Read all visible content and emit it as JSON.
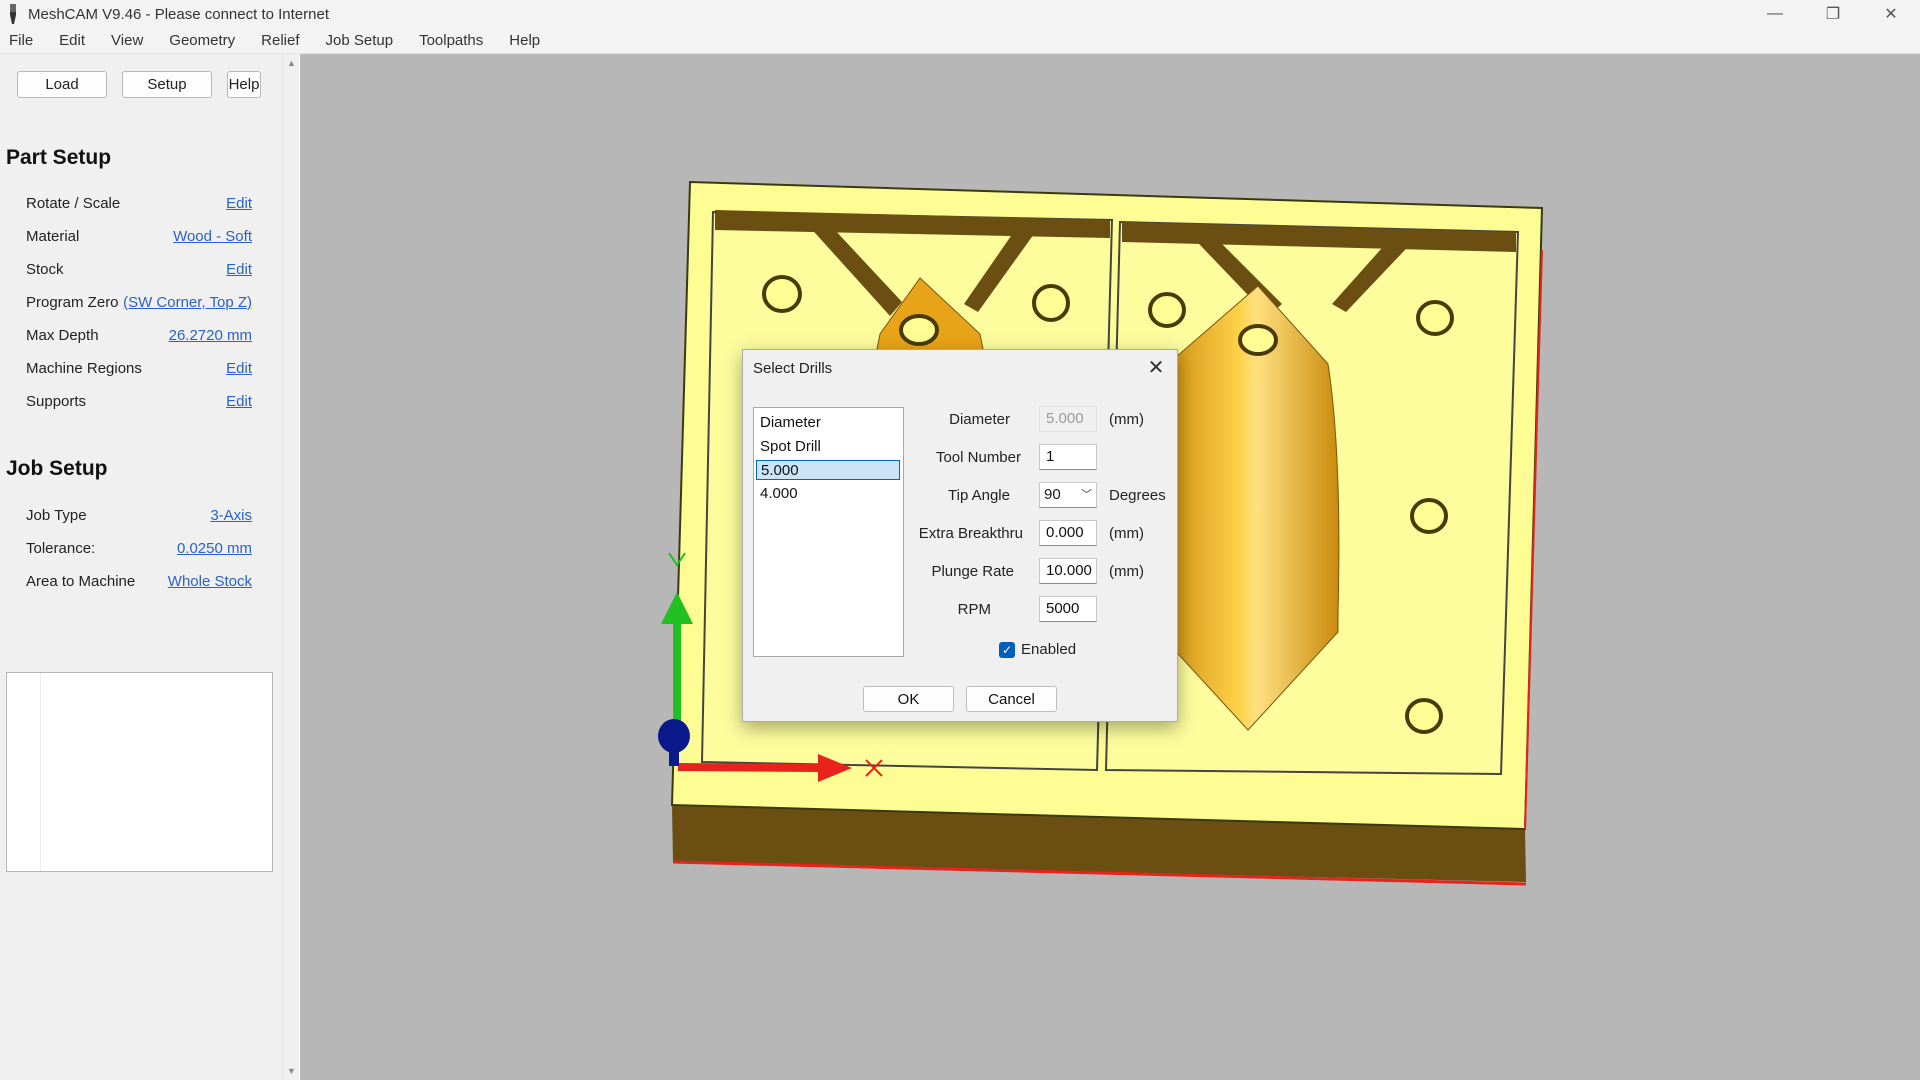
{
  "window": {
    "title": "MeshCAM V9.46 - Please connect to Internet",
    "controls": {
      "minimize": "—",
      "restore": "❐",
      "close": "✕"
    }
  },
  "menu": [
    "File",
    "Edit",
    "View",
    "Geometry",
    "Relief",
    "Job Setup",
    "Toolpaths",
    "Help"
  ],
  "toolbar": {
    "load": "Load",
    "setup": "Setup",
    "help": "Help"
  },
  "part_setup": {
    "title": "Part Setup",
    "rows": [
      {
        "label": "Rotate / Scale",
        "value": "Edit"
      },
      {
        "label": "Material",
        "value": "Wood - Soft"
      },
      {
        "label": "Stock",
        "value": "Edit"
      },
      {
        "label": "Program Zero",
        "value": "(SW Corner, Top Z)"
      },
      {
        "label": "Max Depth",
        "value": "26.2720 mm"
      },
      {
        "label": "Machine Regions",
        "value": "Edit"
      },
      {
        "label": "Supports",
        "value": "Edit"
      }
    ]
  },
  "job_setup": {
    "title": "Job Setup",
    "rows": [
      {
        "label": "Job Type",
        "value": "3-Axis"
      },
      {
        "label": "Tolerance:",
        "value": "0.0250 mm"
      },
      {
        "label": "Area to Machine",
        "value": "Whole Stock"
      }
    ]
  },
  "viewport": {
    "colors": {
      "background": "#b7b7b7",
      "stock": "#fdfd94",
      "part": "#e8a418",
      "pocket": "#6b4e11",
      "x_axis": "#e8231b",
      "y_axis": "#20c020",
      "z_axis": "#0a1a8a"
    }
  },
  "dialog": {
    "title": "Select Drills",
    "close": "✕",
    "list": [
      "Diameter",
      "Spot Drill",
      "5.000",
      "4.000"
    ],
    "selected_index": 2,
    "fields": {
      "diameter": {
        "label": "Diameter",
        "value": "5.000",
        "unit": "(mm)"
      },
      "tool_number": {
        "label": "Tool Number",
        "value": "1"
      },
      "tip_angle": {
        "label": "Tip Angle",
        "value": "90",
        "unit": "Degrees"
      },
      "extra_breakthru": {
        "label": "Extra Breakthru",
        "value": "0.000",
        "unit": "(mm)"
      },
      "plunge_rate": {
        "label": "Plunge Rate",
        "value": "10.000",
        "unit": "(mm)"
      },
      "rpm": {
        "label": "RPM",
        "value": "5000"
      }
    },
    "enabled": {
      "label": "Enabled",
      "checked": true
    },
    "ok": "OK",
    "cancel": "Cancel"
  }
}
